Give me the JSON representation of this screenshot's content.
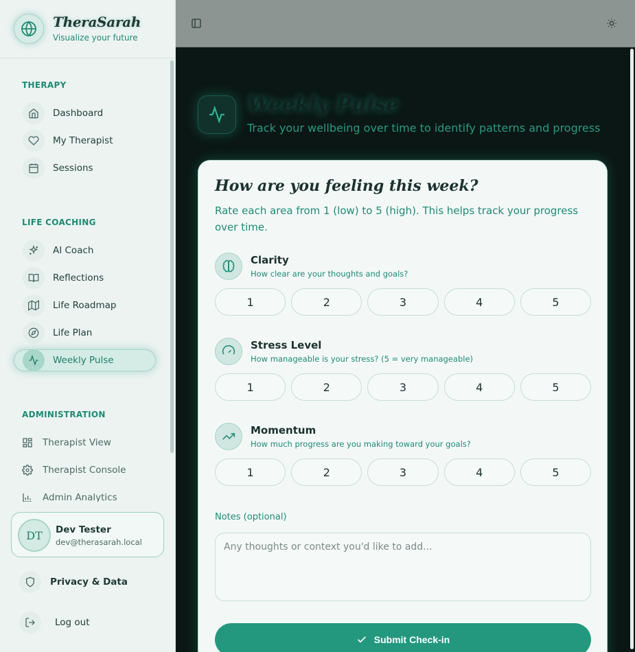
{
  "brand": {
    "name": "TheraSarah",
    "tagline": "Visualize your future"
  },
  "sidebar": {
    "sections": [
      {
        "label": "THERAPY"
      },
      {
        "label": "LIFE COACHING"
      },
      {
        "label": "ADMINISTRATION"
      }
    ],
    "items": [
      {
        "label": "Dashboard",
        "icon": "home-icon"
      },
      {
        "label": "My Therapist",
        "icon": "heart-icon"
      },
      {
        "label": "Sessions",
        "icon": "calendar-icon"
      },
      {
        "label": "AI Coach",
        "icon": "sparkles-icon"
      },
      {
        "label": "Reflections",
        "icon": "book-icon"
      },
      {
        "label": "Life Roadmap",
        "icon": "map-icon"
      },
      {
        "label": "Life Plan",
        "icon": "compass-icon"
      },
      {
        "label": "Weekly Pulse",
        "icon": "activity-icon",
        "active": true
      },
      {
        "label": "Therapist View",
        "icon": "layout-grid-icon"
      },
      {
        "label": "Therapist Console",
        "icon": "settings-icon"
      },
      {
        "label": "Admin Analytics",
        "icon": "bar-chart-icon"
      }
    ]
  },
  "user": {
    "initials": "DT",
    "name": "Dev Tester",
    "email": "dev@therasarah.local"
  },
  "footer": {
    "privacy": "Privacy & Data",
    "logout": "Log out"
  },
  "page": {
    "title": "Weekly Pulse",
    "subtitle": "Track your wellbeing over time to identify patterns and progress"
  },
  "card": {
    "title": "How are you feeling this week?",
    "description": "Rate each area from 1 (low) to 5 (high). This helps track your progress over time.",
    "metrics": [
      {
        "name": "Clarity",
        "desc": "How clear are your thoughts and goals?",
        "icon": "brain-icon"
      },
      {
        "name": "Stress Level",
        "desc": "How manageable is your stress? (5 = very manageable)",
        "icon": "gauge-icon"
      },
      {
        "name": "Momentum",
        "desc": "How much progress are you making toward your goals?",
        "icon": "trending-up-icon"
      }
    ],
    "scale": [
      "1",
      "2",
      "3",
      "4",
      "5"
    ],
    "notes_label": "Notes (optional)",
    "notes_placeholder": "Any thoughts or context you'd like to add...",
    "submit_label": "Submit Check-in"
  },
  "colors": {
    "accent": "#24987e",
    "accent_text": "#1f8a74",
    "sidebar_bg": "#ecf3f1",
    "main_bg": "#0b1714"
  }
}
